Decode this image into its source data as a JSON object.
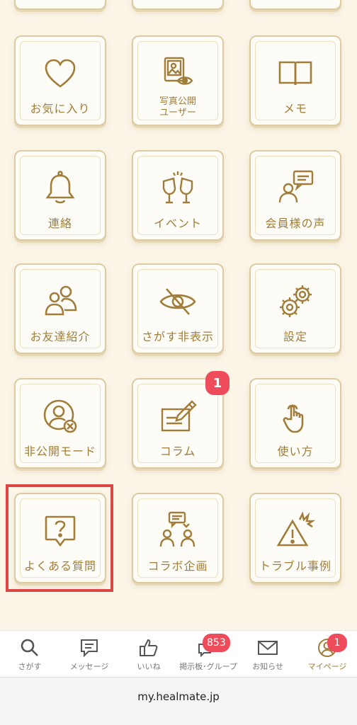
{
  "grid": {
    "tiles": [
      {
        "label": "お気に入り",
        "icon": "heart-icon"
      },
      {
        "label": "写真公開\nユーザー",
        "icon": "photo-eye-icon"
      },
      {
        "label": "メモ",
        "icon": "book-icon"
      },
      {
        "label": "連絡",
        "icon": "bell-icon"
      },
      {
        "label": "イベント",
        "icon": "toast-glasses-icon"
      },
      {
        "label": "会員様の声",
        "icon": "person-speech-icon"
      },
      {
        "label": "お友達紹介",
        "icon": "two-people-icon"
      },
      {
        "label": "さがす非表示",
        "icon": "eye-off-icon"
      },
      {
        "label": "設定",
        "icon": "gears-icon"
      },
      {
        "label": "非公開モード",
        "icon": "user-hidden-icon"
      },
      {
        "label": "コラム",
        "icon": "pencil-paper-icon",
        "badge": "1"
      },
      {
        "label": "使い方",
        "icon": "tap-hand-icon"
      },
      {
        "label": "よくある質問",
        "icon": "question-bubble-icon",
        "highlighted": true
      },
      {
        "label": "コラボ企画",
        "icon": "collab-people-icon"
      },
      {
        "label": "トラブル事例",
        "icon": "warning-icon"
      }
    ]
  },
  "tabbar": {
    "items": [
      {
        "label": "さがす",
        "icon": "search-icon"
      },
      {
        "label": "メッセージ",
        "icon": "message-icon"
      },
      {
        "label": "いいね",
        "icon": "thumbs-up-icon"
      },
      {
        "label": "掲示板･グループ",
        "icon": "board-icon",
        "badge": "853"
      },
      {
        "label": "お知らせ",
        "icon": "mail-icon"
      },
      {
        "label": "マイページ",
        "icon": "user-icon",
        "badge": "1"
      }
    ]
  },
  "browser": {
    "url": "my.healmate.jp"
  },
  "colors": {
    "accent": "#a07d3a",
    "badge": "#ee4b5b",
    "highlight": "#de4545",
    "background": "#fbf5e8"
  }
}
